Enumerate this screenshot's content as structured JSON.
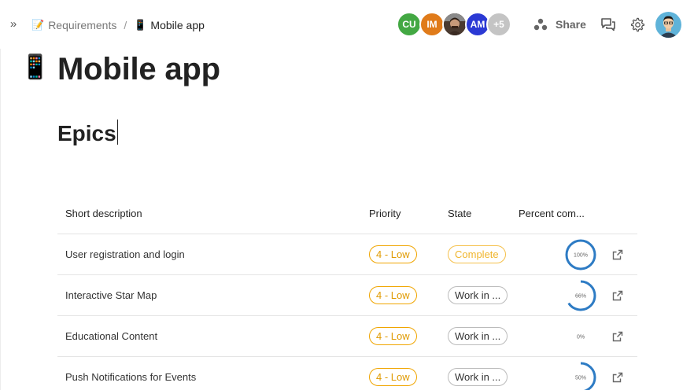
{
  "breadcrumb": {
    "parent": {
      "emoji": "📝",
      "label": "Requirements"
    },
    "separator": "/",
    "current": {
      "emoji": "📱",
      "label": "Mobile app"
    }
  },
  "collaborators": {
    "avatars": [
      {
        "initials": "CU",
        "color": "#43a843"
      },
      {
        "initials": "IM",
        "color": "#e07b1a"
      },
      {
        "initials": "",
        "color": "#5a4a3e"
      },
      {
        "initials": "AM",
        "color": "#2b39d4"
      }
    ],
    "overflow": {
      "label": "+5",
      "color": "#c4c4c4"
    }
  },
  "header": {
    "share_label": "Share",
    "icons": [
      "share-icon",
      "comments-icon",
      "settings-icon",
      "user-avatar"
    ]
  },
  "page": {
    "emoji": "📱",
    "title": "Mobile app",
    "heading": "Epics"
  },
  "table": {
    "columns": [
      "Short description",
      "Priority",
      "State",
      "Percent com..."
    ],
    "rows": [
      {
        "description": "User registration and login",
        "priority": "4 - Low",
        "state": "Complete",
        "state_style": "complete",
        "percent": 100,
        "percent_label": "100%"
      },
      {
        "description": "Interactive Star Map",
        "priority": "4 - Low",
        "state": "Work in ...",
        "state_style": "wip",
        "percent": 66,
        "percent_label": "66%"
      },
      {
        "description": "Educational Content",
        "priority": "4 - Low",
        "state": "Work in ...",
        "state_style": "wip",
        "percent": 0,
        "percent_label": "0%"
      },
      {
        "description": "Push Notifications for Events",
        "priority": "4 - Low",
        "state": "Work in ...",
        "state_style": "wip",
        "percent": 50,
        "percent_label": "50%"
      }
    ]
  },
  "colors": {
    "accent": "#2d7bc4",
    "priority_low": "#f0a500",
    "complete": "#f5c04a"
  }
}
